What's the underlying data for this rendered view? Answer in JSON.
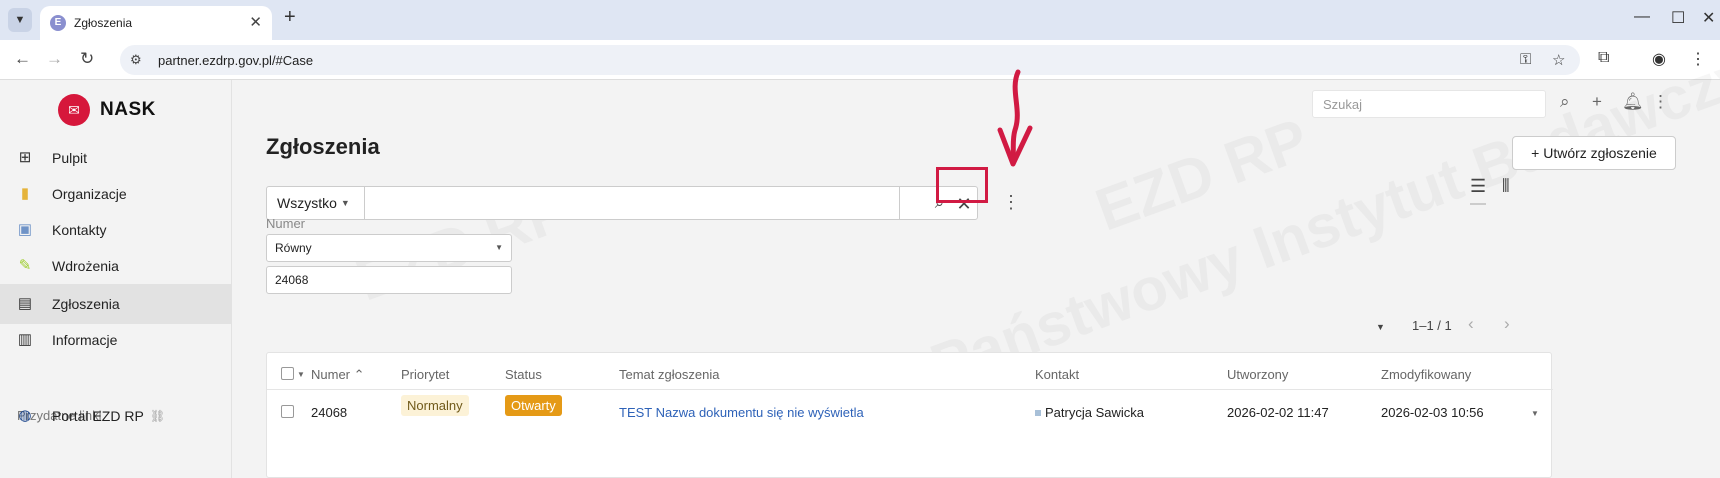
{
  "browser": {
    "tab_title": "Zgłoszenia",
    "tab_favicon": "E",
    "url": "partner.ezdrp.gov.pl/#Case"
  },
  "sidebar": {
    "logo_text": "NASK",
    "items": [
      {
        "label": "Pulpit",
        "icon": "grid-icon",
        "color": "#333333"
      },
      {
        "label": "Organizacje",
        "icon": "building-icon",
        "color": "#e5b33a"
      },
      {
        "label": "Kontakty",
        "icon": "contact-card-icon",
        "color": "#6f93c7"
      },
      {
        "label": "Wdrożenia",
        "icon": "pencil-icon",
        "color": "#9ccc2a"
      },
      {
        "label": "Zgłoszenia",
        "icon": "briefcase-icon",
        "color": "#333333"
      },
      {
        "label": "Informacje",
        "icon": "book-icon",
        "color": "#333333"
      }
    ],
    "section_title": "Przydatne linki",
    "links": [
      {
        "label": "Portal EZD RP",
        "icon": "globe-icon"
      }
    ]
  },
  "header": {
    "search_placeholder": "Szukaj"
  },
  "page": {
    "title": "Zgłoszenia",
    "create_button": "+ Utwórz zgłoszenie",
    "filter_scope": "Wszystko",
    "filter_field_label": "Numer",
    "filter_operator": "Równy",
    "filter_value": "24068",
    "pagination": "1–1 / 1"
  },
  "table": {
    "columns": [
      "Numer",
      "Priorytet",
      "Status",
      "Temat zgłoszenia",
      "Kontakt",
      "Utworzony",
      "Zmodyfikowany"
    ],
    "rows": [
      {
        "numer": "24068",
        "priorytet": "Normalny",
        "status": "Otwarty",
        "temat": "TEST Nazwa dokumentu się nie wyświetla",
        "kontakt": "Patrycja Sawicka",
        "utworzony": "2026-02-02 11:47",
        "zmodyfikowany": "2026-02-03 10:56"
      }
    ]
  },
  "colors": {
    "annotation": "#d11a43",
    "brand": "#d6173b",
    "link": "#2e62b8",
    "status_open": "#e59a16",
    "priority_normal_bg": "#fcf2d7"
  }
}
